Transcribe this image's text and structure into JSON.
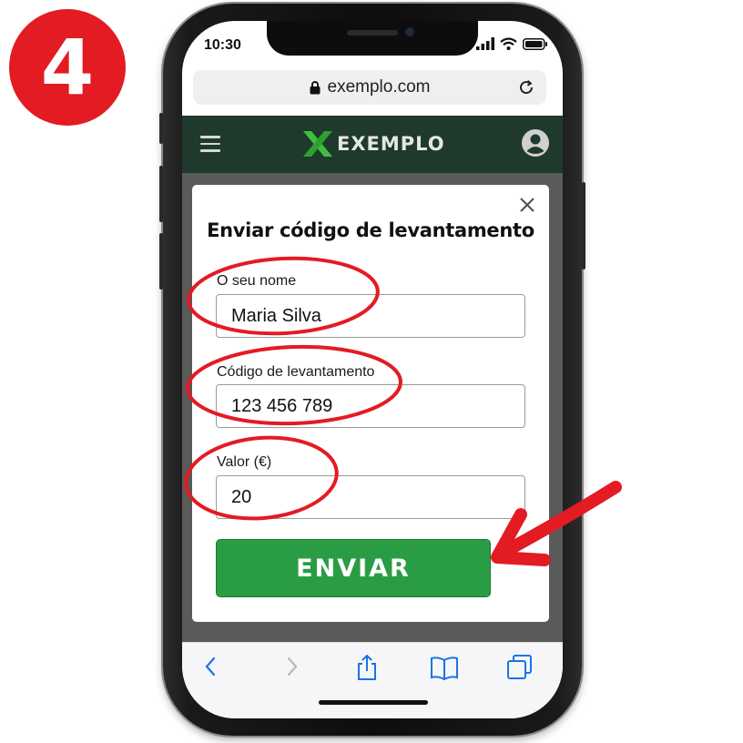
{
  "step": {
    "number": "4",
    "color": "#e31b23"
  },
  "status_bar": {
    "time": "10:30",
    "icons": [
      "signal-icon",
      "wifi-icon",
      "battery-icon"
    ]
  },
  "browser": {
    "url": "exemplo.com",
    "lock_icon": "lock-icon",
    "reload_icon": "reload-icon"
  },
  "site_header": {
    "menu_icon": "hamburger-menu-icon",
    "brand": "EXEMPLO",
    "logo_icon": "x-logo-icon",
    "account_icon": "user-account-icon",
    "color": "#1f3a2c"
  },
  "modal": {
    "title": "Enviar código de levantamento",
    "close_icon": "close-icon",
    "fields": [
      {
        "label": "O seu nome",
        "value": "Maria Silva"
      },
      {
        "label": "Código de levantamento",
        "value": "123 456 789"
      },
      {
        "label": "Valor (€)",
        "value": "20"
      }
    ],
    "submit_label": "ENVIAR",
    "submit_color": "#2a9d44"
  },
  "toolbar": {
    "icons": [
      "back-icon",
      "forward-icon",
      "share-icon",
      "bookmarks-icon",
      "tabs-icon"
    ]
  },
  "annotation_color": "#e31b23"
}
